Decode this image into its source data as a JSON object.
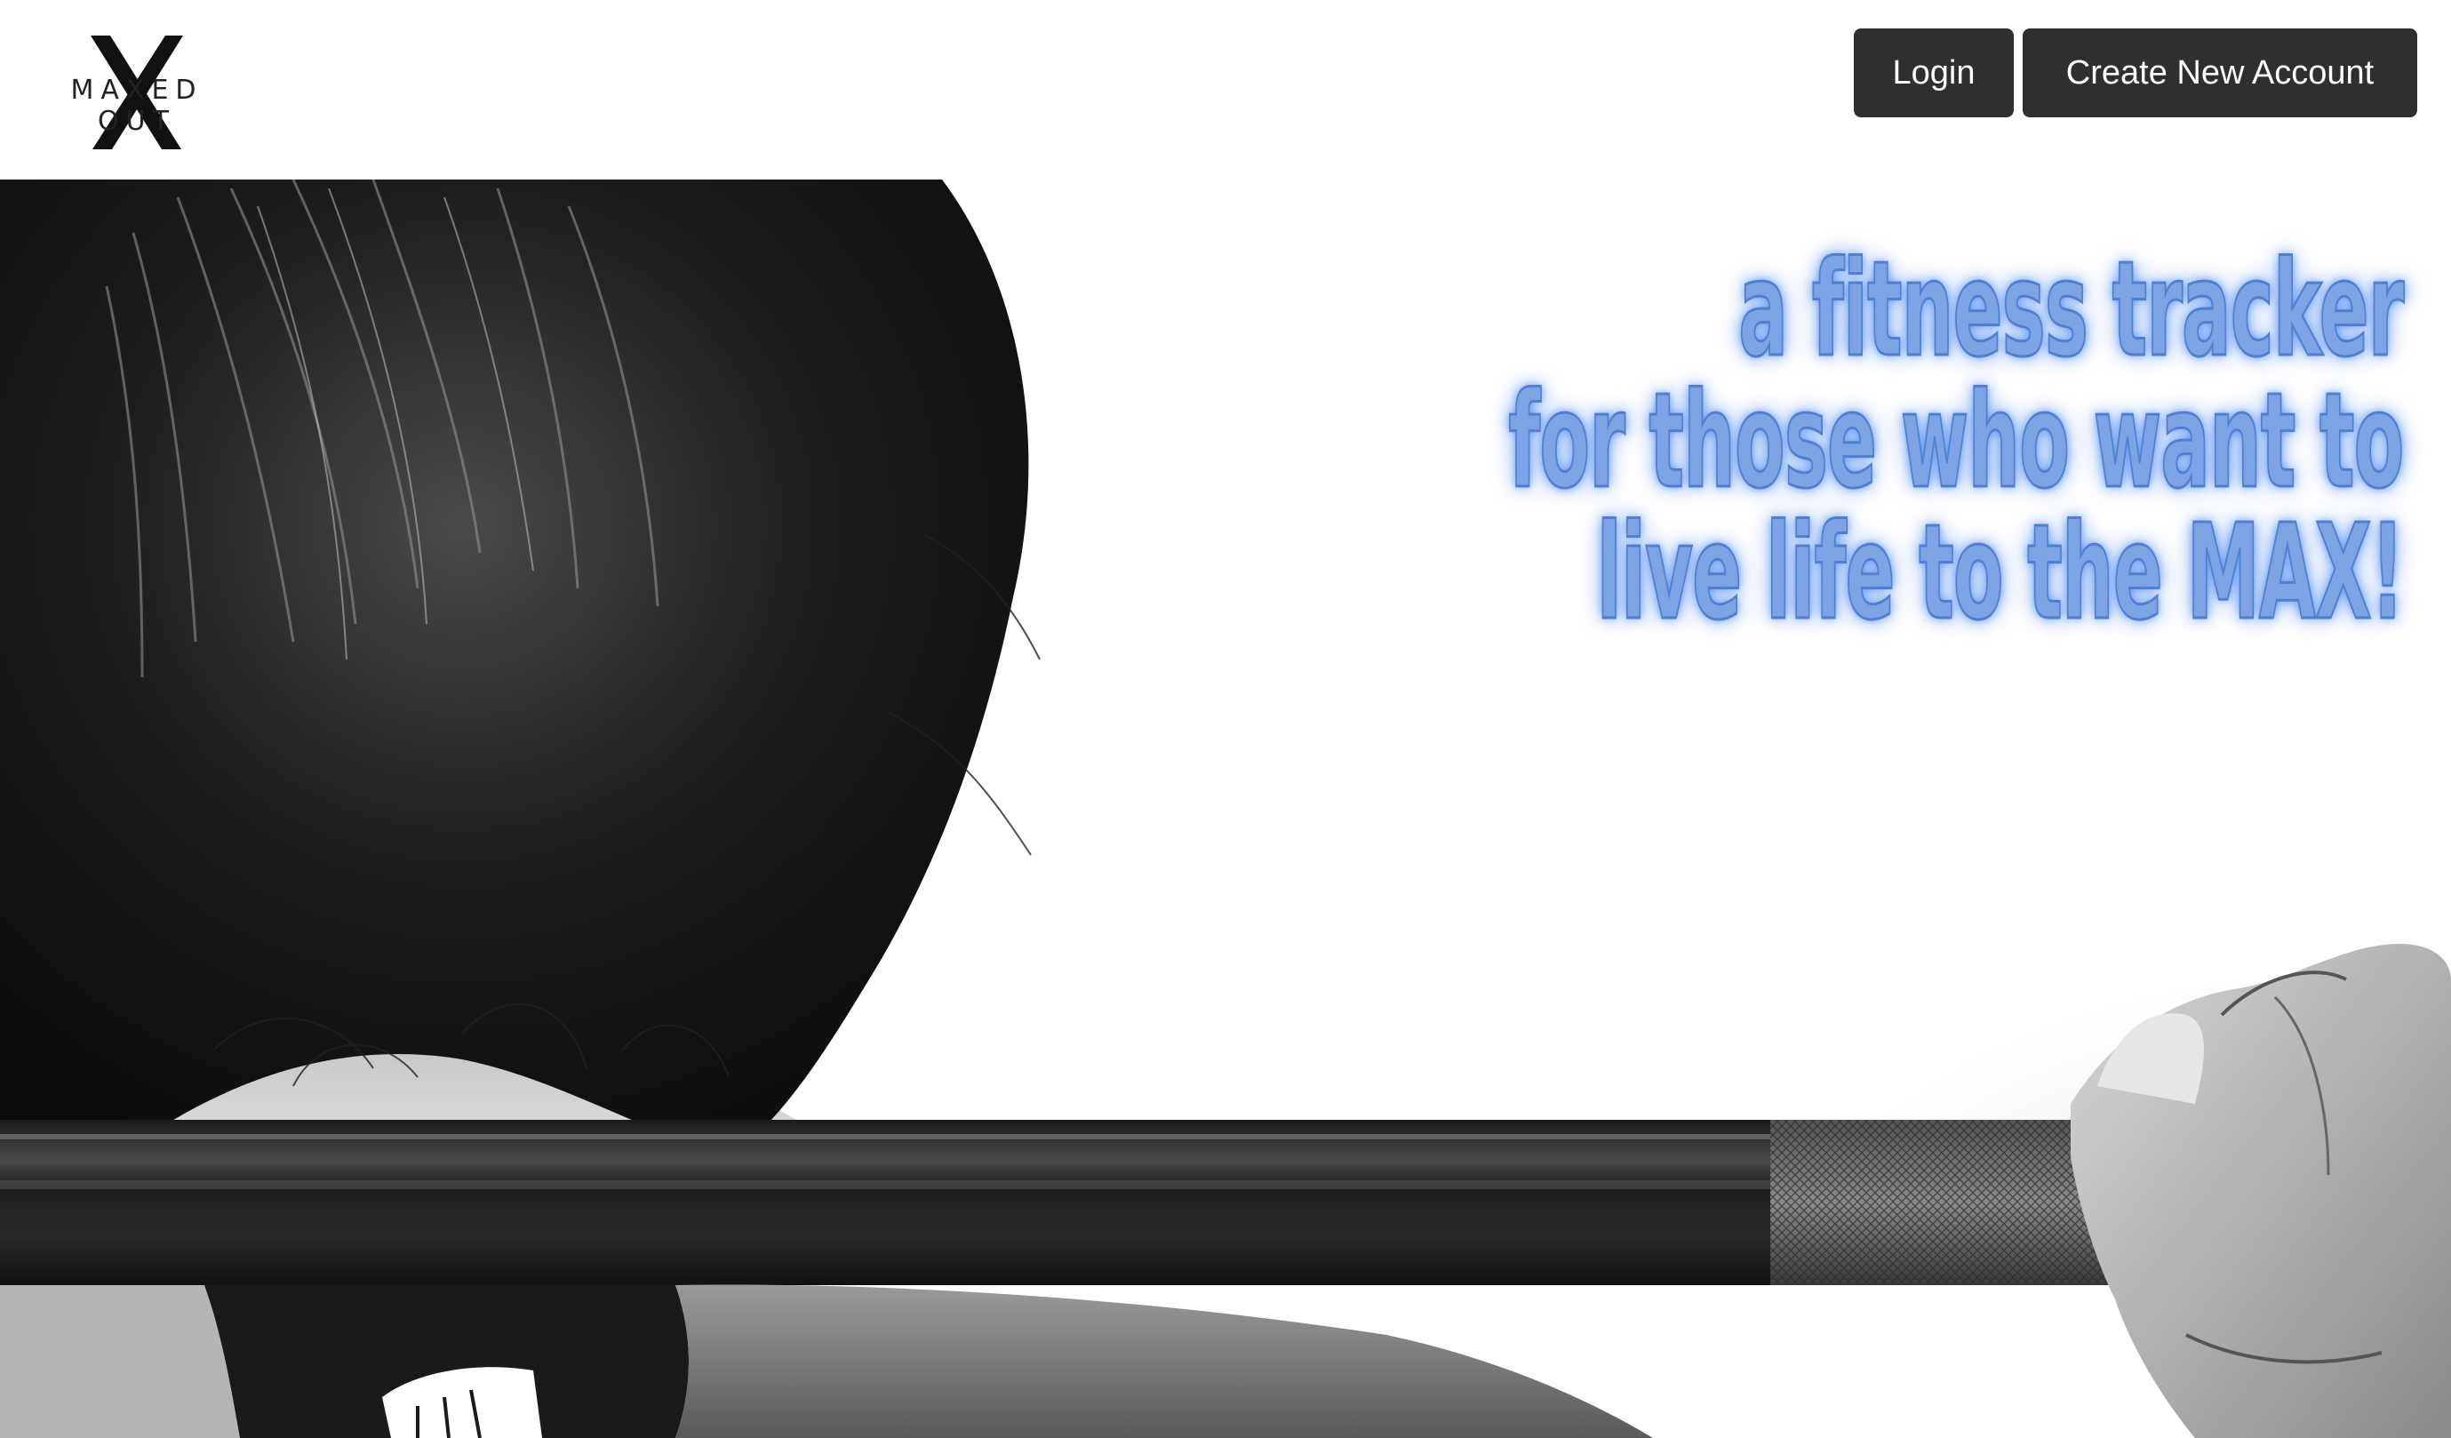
{
  "navbar": {
    "logo_text": "MAXED OUT",
    "login_label": "Login",
    "create_account_label": "Create New Account"
  },
  "hero": {
    "image_icon": "barbell-squat-photo",
    "tagline_lines": [
      "a fitness tracker",
      "for those who want to",
      "live life to the MAX!"
    ],
    "tagline_color": "#7ea3e4",
    "glow_color": "#508cf0"
  },
  "colors": {
    "button_bg": "#2f2f2f",
    "button_text": "#ffffff",
    "navbar_bg": "#ffffff"
  }
}
